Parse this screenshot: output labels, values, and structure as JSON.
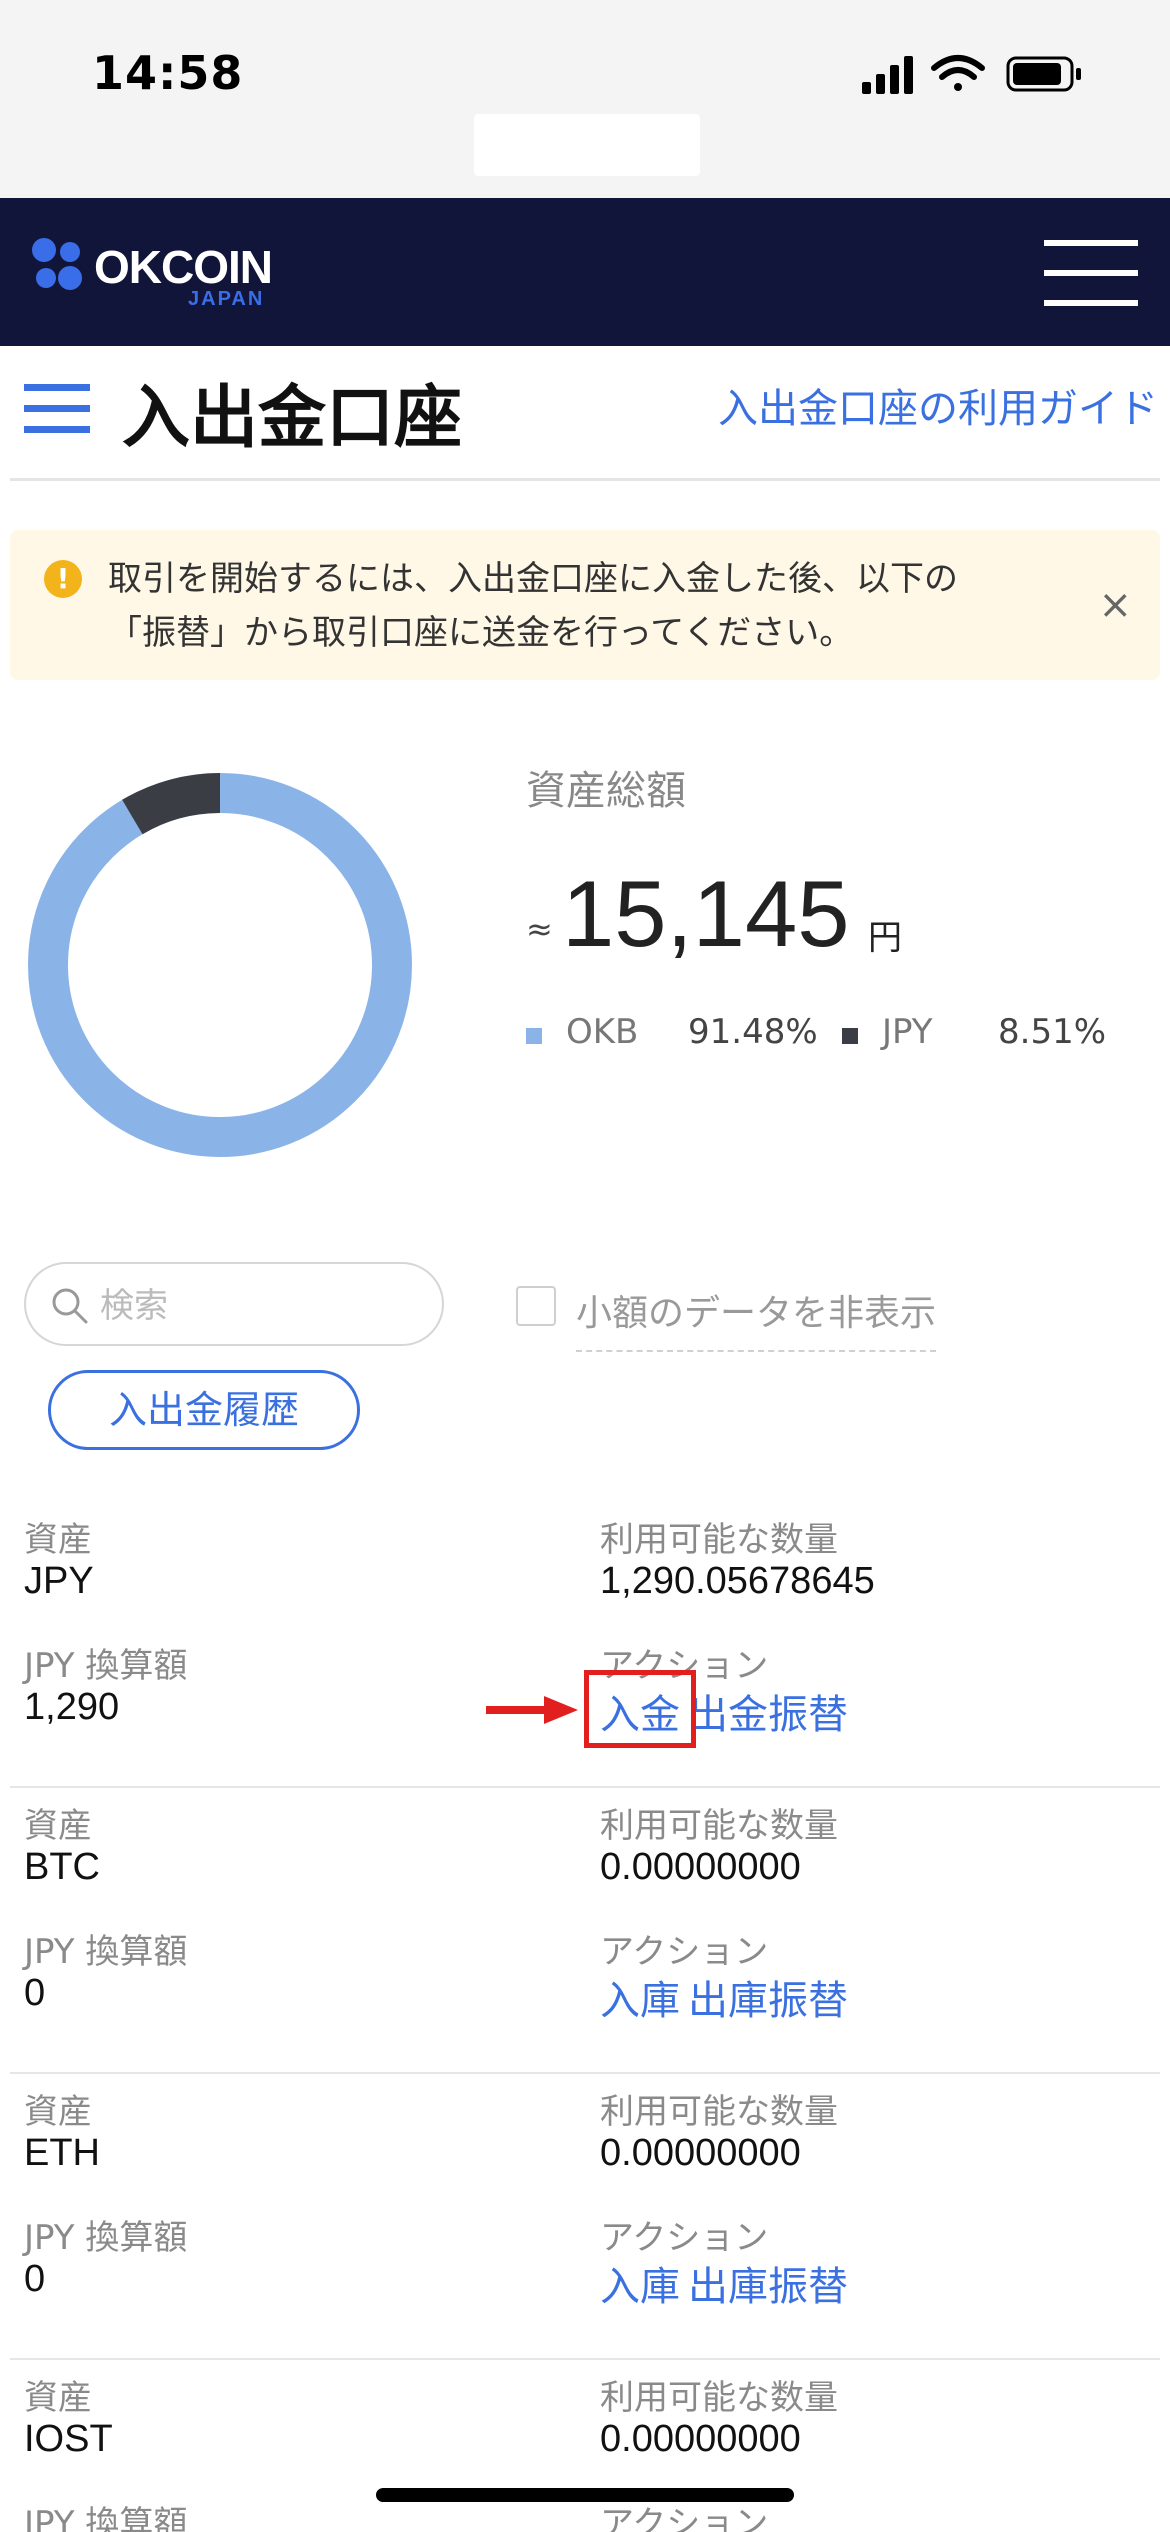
{
  "status_bar": {
    "time": "14:58"
  },
  "header": {
    "logo_text": "OKCOIN",
    "logo_sub": "JAPAN"
  },
  "page": {
    "title": "入出金口座",
    "guide_link": "入出金口座の利用ガイド"
  },
  "alert": {
    "icon": "!",
    "line1": "取引を開始するには、入出金口座に入金した後、以下の",
    "line2": "「振替」から取引口座に送金を行ってください。",
    "close": "×"
  },
  "summary": {
    "label": "資産総額",
    "approx": "≈",
    "value": "15,145",
    "unit": "円",
    "legend": [
      {
        "name": "OKB",
        "percent": "91.48%",
        "color": "#8ab4e8"
      },
      {
        "name": "JPY",
        "percent": "8.51%",
        "color": "#3a3d44"
      }
    ],
    "donut_fractions": {
      "okb": 0.9148,
      "jpy": 0.0851
    }
  },
  "controls": {
    "search_placeholder": "検索",
    "hide_small_label": "小額のデータを非表示",
    "history_button": "入出金履歴"
  },
  "labels": {
    "asset": "資産",
    "available": "利用可能な数量",
    "jpy_value": "JPY 換算額",
    "action": "アクション"
  },
  "assets": [
    {
      "symbol": "JPY",
      "available": "1,290.05678645",
      "jpy_value": "1,290",
      "action_in": "入金",
      "action_out": "出金",
      "action_transfer": "振替"
    },
    {
      "symbol": "BTC",
      "available": "0.00000000",
      "jpy_value": "0",
      "action_in": "入庫",
      "action_out": "出庫",
      "action_transfer": "振替"
    },
    {
      "symbol": "ETH",
      "available": "0.00000000",
      "jpy_value": "0",
      "action_in": "入庫",
      "action_out": "出庫",
      "action_transfer": "振替"
    },
    {
      "symbol": "IOST",
      "available": "0.00000000",
      "jpy_value": "",
      "action_in": "",
      "action_out": "",
      "action_transfer": ""
    }
  ],
  "colors": {
    "accent": "#3a70e0",
    "header_bg": "#12153a",
    "highlight": "#e21f1f"
  }
}
